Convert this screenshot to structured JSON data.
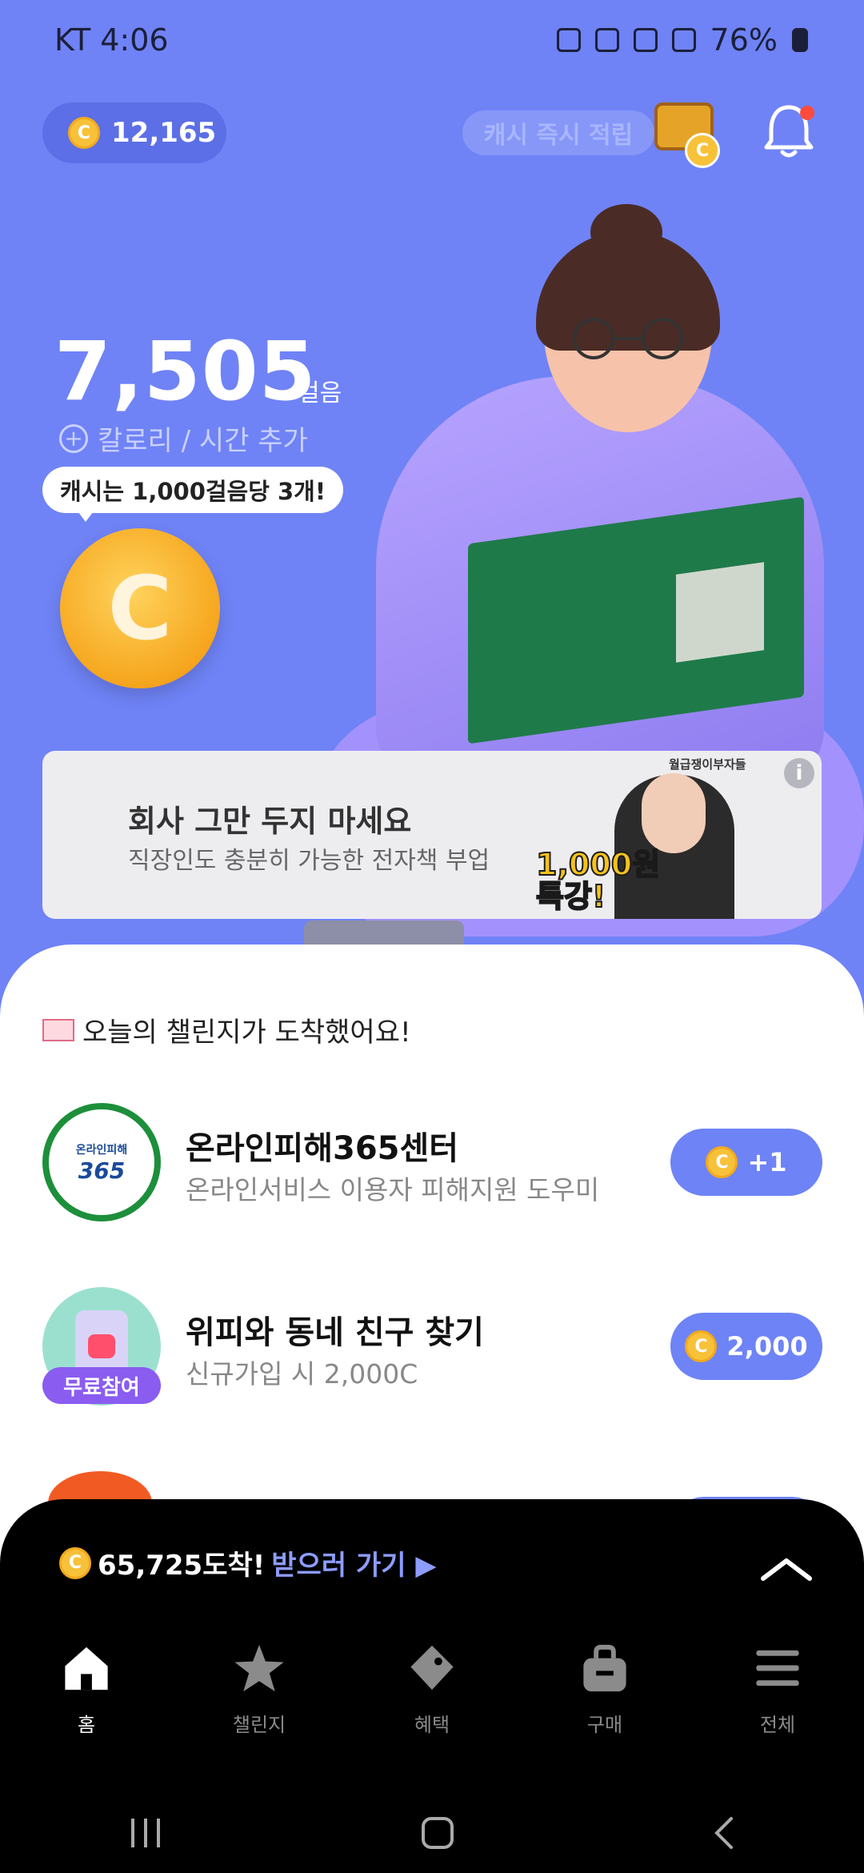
{
  "status_bar": {
    "carrier_time": "KT 4:06",
    "battery": "76%"
  },
  "header": {
    "coin_balance": "12,165",
    "coin_symbol": "C",
    "cash_button": "캐시 즉시 적립"
  },
  "steps": {
    "count": "7,505",
    "unit": "걸음",
    "add_label": "칼로리 / 시간 추가",
    "bubble_text": "캐시는 1,000걸음당 3개!",
    "big_coin_symbol": "C"
  },
  "ad": {
    "brand": "월급쟁이부자들",
    "title": "회사 그만 두지 마세요",
    "subtitle": "직장인도 충분히 가능한 전자책 부업",
    "promo_line1": "1,000원",
    "promo_line2": "특강!",
    "info_icon": "i"
  },
  "challenges": {
    "heading": "오늘의 챌린지가 도착했어요!",
    "items": [
      {
        "title": "온라인피해365센터",
        "subtitle": "온라인서비스 이용자 피해지원 도우미",
        "reward": "+1",
        "logo_text_small": "온라인피해",
        "logo_text_big": "365"
      },
      {
        "title": "위피와 동네 친구 찾기",
        "subtitle": "신규가입 시 2,000C",
        "reward": "2,000",
        "badge": "무료참여"
      }
    ]
  },
  "bottom_panel": {
    "amount_text": "65,725도착!",
    "go_text": "받으러 가기 ▶"
  },
  "nav": {
    "items": [
      {
        "label": "홈",
        "icon": "home-icon"
      },
      {
        "label": "챌린지",
        "icon": "star-icon"
      },
      {
        "label": "혜택",
        "icon": "tag-icon"
      },
      {
        "label": "구매",
        "icon": "bag-icon"
      },
      {
        "label": "전체",
        "icon": "menu-icon"
      }
    ]
  },
  "colors": {
    "background": "#6f83f6",
    "accent": "#6e83f6",
    "coin": "#f8c13a",
    "panel": "#000000"
  }
}
